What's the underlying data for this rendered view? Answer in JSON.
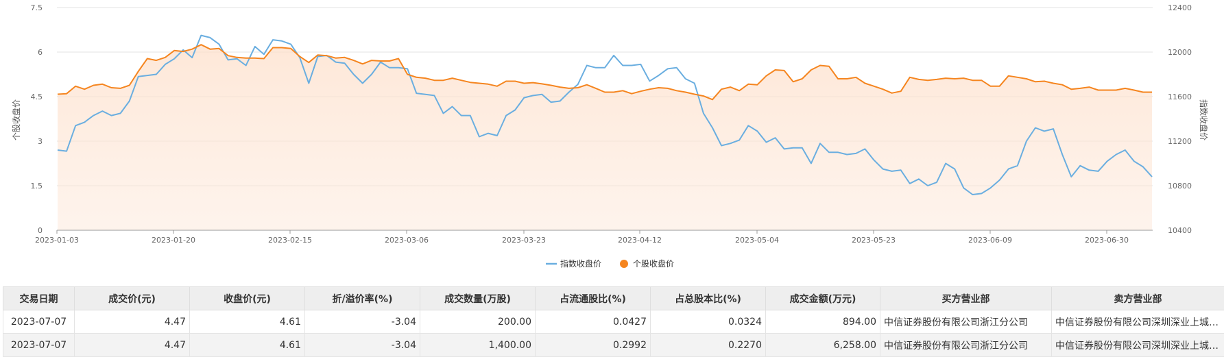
{
  "chart_data": {
    "type": "line",
    "x_ticks": [
      "2023-01-03",
      "2023-01-20",
      "2023-02-15",
      "2023-03-06",
      "2023-03-23",
      "2023-04-12",
      "2023-05-04",
      "2023-05-23",
      "2023-06-09",
      "2023-06-30"
    ],
    "left_axis": {
      "title": "个股收盘价",
      "ticks": [
        "0",
        "1.5",
        "3",
        "4.5",
        "6",
        "7.5"
      ],
      "ylim": [
        0,
        7.5
      ]
    },
    "right_axis": {
      "title": "指数收盘价",
      "ticks": [
        "10400",
        "10800",
        "11200",
        "11600",
        "12000",
        "12400"
      ],
      "ylim": [
        10400,
        12400
      ]
    },
    "grid": true,
    "legend_position": "bottom-center",
    "series": [
      {
        "name": "指数收盘价",
        "axis": "right",
        "color": "#6aaee0",
        "values": [
          11120,
          11110,
          11340,
          11370,
          11430,
          11470,
          11430,
          11450,
          11560,
          11780,
          11790,
          11800,
          11890,
          11940,
          12020,
          11950,
          12150,
          12130,
          12070,
          11930,
          11940,
          11880,
          12050,
          11980,
          12110,
          12100,
          12070,
          11950,
          11720,
          11960,
          11970,
          11910,
          11900,
          11800,
          11720,
          11800,
          11910,
          11860,
          11860,
          11850,
          11630,
          11620,
          11610,
          11450,
          11510,
          11430,
          11430,
          11240,
          11270,
          11250,
          11430,
          11480,
          11590,
          11610,
          11620,
          11550,
          11560,
          11640,
          11710,
          11880,
          11860,
          11860,
          11970,
          11880,
          11880,
          11890,
          11740,
          11790,
          11850,
          11860,
          11760,
          11720,
          11450,
          11320,
          11160,
          11180,
          11210,
          11340,
          11290,
          11190,
          11230,
          11130,
          11140,
          11140,
          11000,
          11180,
          11100,
          11100,
          11080,
          11090,
          11130,
          11030,
          10950,
          10930,
          10940,
          10820,
          10860,
          10800,
          10830,
          11000,
          10950,
          10780,
          10720,
          10730,
          10780,
          10850,
          10950,
          10980,
          11200,
          11320,
          11290,
          11310,
          11080,
          10880,
          10980,
          10940,
          10930,
          11020,
          11080,
          11120,
          11020,
          10970,
          10880
        ]
      },
      {
        "name": "个股收盘价",
        "axis": "left",
        "color": "#f5851f",
        "values": [
          4.58,
          4.6,
          4.85,
          4.75,
          4.88,
          4.92,
          4.8,
          4.78,
          4.88,
          5.35,
          5.78,
          5.72,
          5.82,
          6.05,
          6.02,
          6.1,
          6.25,
          6.1,
          6.12,
          5.88,
          5.82,
          5.8,
          5.8,
          5.78,
          6.15,
          6.15,
          6.12,
          5.85,
          5.65,
          5.9,
          5.88,
          5.8,
          5.82,
          5.72,
          5.6,
          5.72,
          5.7,
          5.7,
          5.78,
          5.25,
          5.15,
          5.12,
          5.05,
          5.05,
          5.12,
          5.05,
          4.98,
          4.95,
          4.92,
          4.85,
          5.02,
          5.02,
          4.95,
          4.97,
          4.93,
          4.88,
          4.82,
          4.78,
          4.8,
          4.9,
          4.78,
          4.65,
          4.65,
          4.7,
          4.6,
          4.68,
          4.75,
          4.8,
          4.78,
          4.7,
          4.65,
          4.58,
          4.52,
          4.4,
          4.75,
          4.82,
          4.7,
          4.92,
          4.9,
          5.2,
          5.4,
          5.38,
          5.0,
          5.1,
          5.4,
          5.55,
          5.52,
          5.1,
          5.1,
          5.15,
          4.95,
          4.85,
          4.75,
          4.62,
          4.68,
          5.15,
          5.08,
          5.05,
          5.08,
          5.12,
          5.1,
          5.12,
          5.05,
          5.05,
          4.85,
          4.85,
          5.2,
          5.15,
          5.1,
          5.0,
          5.02,
          4.95,
          4.9,
          4.75,
          4.78,
          4.82,
          4.72,
          4.72,
          4.72,
          4.78,
          4.72,
          4.65,
          4.65
        ]
      }
    ]
  },
  "table": {
    "headers": [
      "交易日期",
      "成交价(元)",
      "收盘价(元)",
      "折/溢价率(%)",
      "成交数量(万股)",
      "占流通股比(%)",
      "占总股本比(%)",
      "成交金额(万元)",
      "买方营业部",
      "卖方营业部"
    ],
    "rows": [
      [
        "2023-07-07",
        "4.47",
        "4.61",
        "-3.04",
        "200.00",
        "0.0427",
        "0.0324",
        "894.00",
        "中信证券股份有限公司浙江分公司",
        "中信证券股份有限公司深圳深业上城证券营业部"
      ],
      [
        "2023-07-07",
        "4.47",
        "4.61",
        "-3.04",
        "1,400.00",
        "0.2992",
        "0.2270",
        "6,258.00",
        "中信证券股份有限公司浙江分公司",
        "中信证券股份有限公司深圳深业上城证券营业部"
      ]
    ]
  }
}
